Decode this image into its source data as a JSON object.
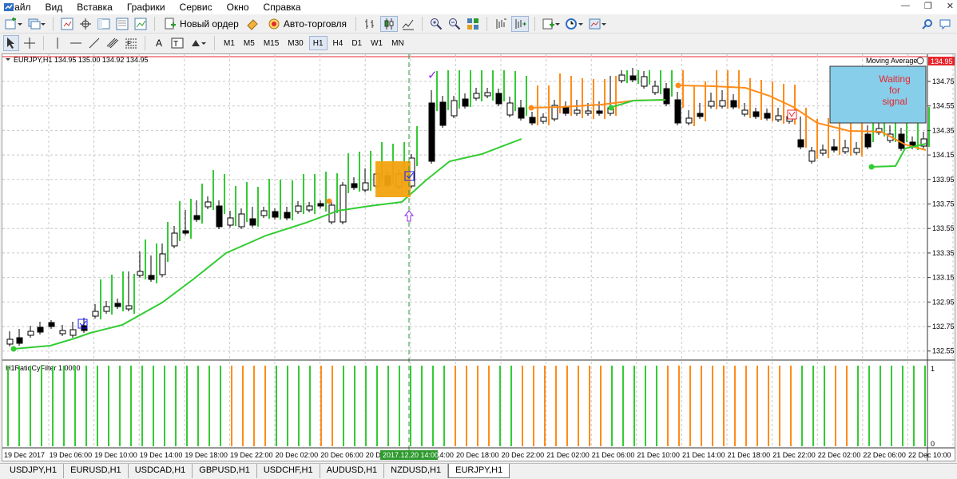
{
  "menu": [
    "Файл",
    "Вид",
    "Вставка",
    "Графики",
    "Сервис",
    "Окно",
    "Справка"
  ],
  "toolbar": {
    "new_order_label": "Новый ордер",
    "autotrade_label": "Авто-торговля",
    "timeframes": [
      "M1",
      "M5",
      "M15",
      "M30",
      "H1",
      "H4",
      "D1",
      "W1",
      "MN"
    ],
    "active_timeframe": "H1"
  },
  "chart": {
    "header": "EURJPY,H1  134.95 135.00 134.92 134.95",
    "indicator_label": "Moving Average",
    "current_price": "134.95",
    "price_labels": [
      "134.75",
      "134.55",
      "134.35",
      "134.15",
      "133.95",
      "133.75",
      "133.55",
      "133.35",
      "133.15",
      "132.95",
      "132.75",
      "132.55"
    ],
    "signal_box": [
      "Waiting",
      "for",
      "signal"
    ],
    "subwindow_label": "H1RatioCyFilter 1.0000",
    "subwindow_scale": [
      "1",
      "0"
    ],
    "time_labels": [
      "19 Dec 2017",
      "19 Dec 06:00",
      "19 Dec 10:00",
      "19 Dec 14:00",
      "19 Dec 18:00",
      "19 Dec 22:00",
      "20 Dec 02:00",
      "20 Dec 06:00",
      "20 Dec 10:00",
      "20 Dec 14:00",
      "20 Dec 18:00",
      "20 Dec 22:00",
      "21 Dec 02:00",
      "21 Dec 06:00",
      "21 Dec 10:00",
      "21 Dec 14:00",
      "21 Dec 18:00",
      "21 Dec 22:00",
      "22 Dec 02:00",
      "22 Dec 06:00",
      "22 Dec 10:00"
    ],
    "cursor_time": "2017.12.20 14:00"
  },
  "colors": {
    "bull": "#33cc33",
    "bear": "#ff8c1a",
    "signal_box": "#87ceeb",
    "signal_text": "#e8262c",
    "cursor": "#2e9a2e"
  },
  "tabs": [
    "USDJPY,H1",
    "EURUSD,H1",
    "USDCAD,H1",
    "GBPUSD,H1",
    "USDCHF,H1",
    "AUDUSD,H1",
    "NZDUSD,H1",
    "EURJPY,H1"
  ],
  "active_tab": "EURJPY,H1"
}
